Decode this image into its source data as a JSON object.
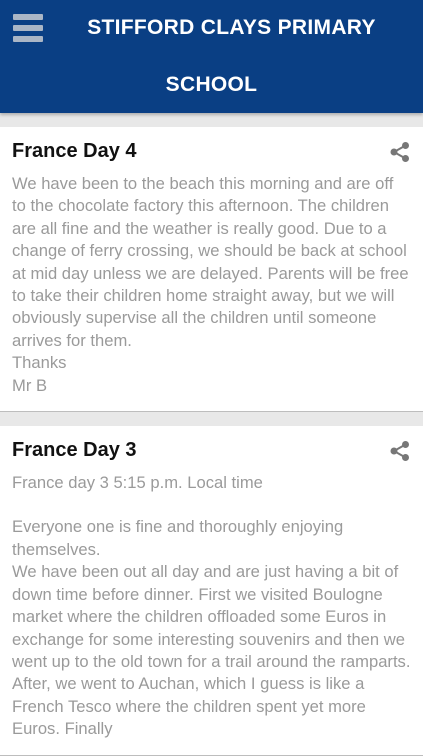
{
  "header": {
    "title_line1": "STIFFORD CLAYS PRIMARY",
    "title_line2": "SCHOOL",
    "menu_icon": "hamburger-menu-icon",
    "background_color": "#0a3f84"
  },
  "posts": [
    {
      "title": "France Day 4",
      "share_icon": "share-icon",
      "body": [
        "We have been to the beach this morning and are off to the chocolate factory this afternoon. The children are all fine and the weather is really good. Due to a change of ferry crossing, we should be back at school at mid day unless we are delayed. Parents will be free to take their children home straight away, but we will obviously supervise all the children until someone arrives for them.",
        "Thanks",
        "Mr B"
      ]
    },
    {
      "title": "France Day 3",
      "share_icon": "share-icon",
      "subtitle": "France day 3 5:15 p.m. Local time",
      "body": [
        "Everyone one is fine and thoroughly enjoying themselves.",
        "We have been out all day and are just having a bit of down time before dinner. First we visited Boulogne market where the children offloaded some Euros in exchange for some interesting souvenirs and then we went up to the old town for a trail around the ramparts. After, we went to Auchan, which I guess is like a French Tesco where the children spent yet more Euros. Finally"
      ]
    }
  ]
}
